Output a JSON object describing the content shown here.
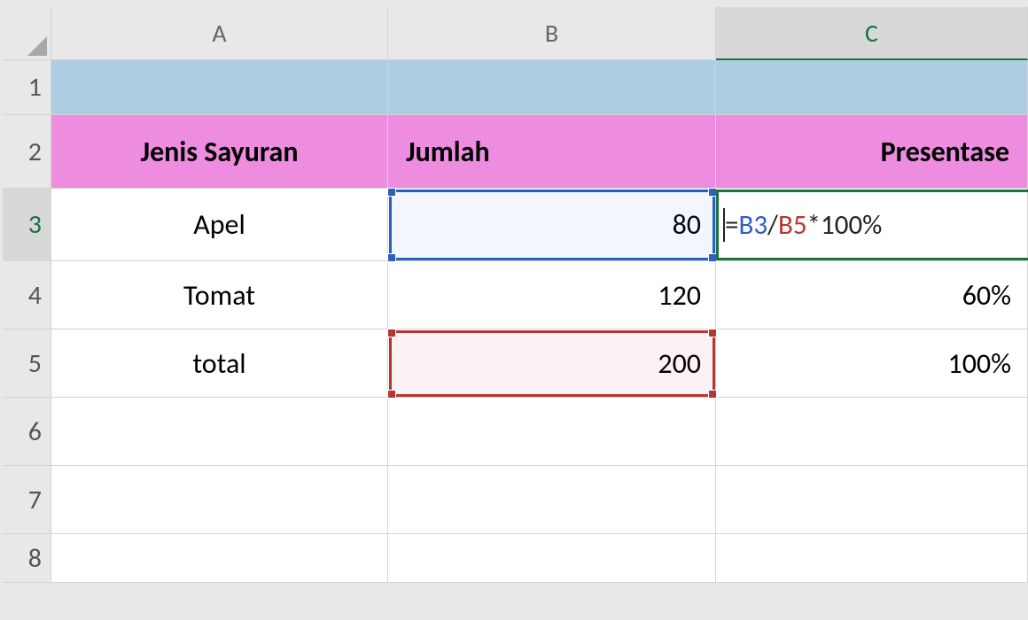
{
  "columns": {
    "a": "A",
    "b": "B",
    "c": "C"
  },
  "rows": {
    "r1": "1",
    "r2": "2",
    "r3": "3",
    "r4": "4",
    "r5": "5",
    "r6": "6",
    "r7": "7",
    "r8": "8"
  },
  "headers": {
    "col_a": "Jenis Sayuran",
    "col_b": "Jumlah",
    "col_c": "Presentase"
  },
  "data": {
    "r3": {
      "a": "Apel",
      "b": "80"
    },
    "r4": {
      "a": "Tomat",
      "b": "120",
      "c": "60%"
    },
    "r5": {
      "a": "total",
      "b": "200",
      "c": "100%"
    }
  },
  "formula": {
    "prefix": "=",
    "ref1": "B3",
    "op1": "/",
    "ref2": "B5",
    "suffix": "*100%"
  },
  "colors": {
    "row1_bg": "#aecde3",
    "row2_bg": "#ee8cdf",
    "ref_blue": "#2b5fc4",
    "ref_red": "#b73535",
    "active_green": "#1a7340"
  }
}
